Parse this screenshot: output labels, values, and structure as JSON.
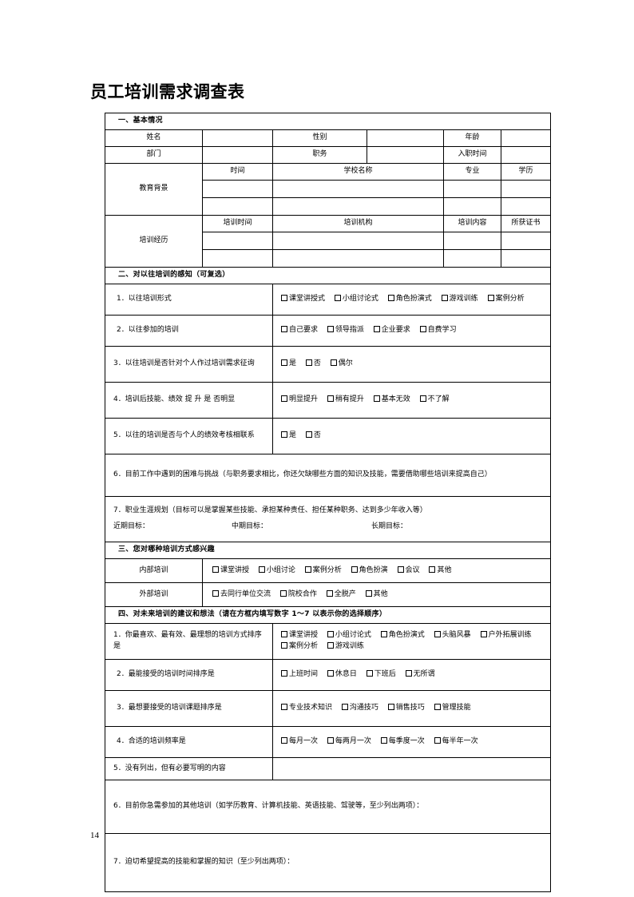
{
  "document": {
    "title": "员工培训需求调查表",
    "page_number": "14"
  },
  "section1": {
    "heading": "一、基本情况",
    "row1": {
      "label1": "姓名",
      "label2": "性别",
      "label3": "年龄"
    },
    "row2": {
      "label1": "部门",
      "label2": "职务",
      "label3": "入职时间"
    },
    "education": {
      "label": "教育背景",
      "headers": [
        "时间",
        "学校名称",
        "专业",
        "学历"
      ]
    },
    "training": {
      "label": "培训经历",
      "headers": [
        "培训时间",
        "培训机构",
        "培训内容",
        "所获证书"
      ]
    }
  },
  "section2": {
    "heading": "二、对以往培训的感知（可复选）",
    "q1": {
      "label": "1．以往培训形式",
      "options": [
        "课堂讲授式",
        "小组讨论式",
        "角色扮演式",
        "游戏训练",
        "案例分析"
      ]
    },
    "q2": {
      "label": "2．以往参加的培训",
      "options": [
        "自己要求",
        "领导指派",
        "企业要求",
        "自费学习"
      ]
    },
    "q3": {
      "label": "3．以往培训是否针对个人作过培训需求征询",
      "options": [
        "是",
        "否",
        "偶尔"
      ]
    },
    "q4": {
      "label": "4．培训后技能、绩效 提 升 是 否明显",
      "options": [
        "明显提升",
        "稍有提升",
        "基本无效",
        "不了解"
      ]
    },
    "q5": {
      "label": "5．以往的培训是否与个人的绩效考核相联系",
      "options": [
        "是",
        "否"
      ]
    },
    "q6": {
      "label": "6．目前工作中遇到的困难与挑战（与职务要求相比，你还欠缺哪些方面的知识及技能，需要借助哪些培训来提高自己）"
    },
    "q7": {
      "label": "7．职业生涯规划（目标可以是掌握某些技能、承担某种责任、担任某种职务、达到多少年收入等）",
      "goal_short": "近期目标：",
      "goal_mid": "中期目标：",
      "goal_long": "长期目标："
    }
  },
  "section3": {
    "heading": "三、您对哪种培训方式感兴趣",
    "internal": {
      "label": "内部培训",
      "options": [
        "课堂讲授",
        "小组讨论",
        "案例分析",
        "角色扮演",
        "会议",
        "其他"
      ]
    },
    "external": {
      "label": "外部培训",
      "options": [
        "去同行单位交流",
        "院校合作",
        "全脱产",
        "其他"
      ]
    }
  },
  "section4": {
    "heading": "四、对未来培训的建议和想法（请在方框内填写数字 1～7 以表示你的选择顺序）",
    "q1": {
      "label": "1．你最喜欢、最有效、最理想的培训方式排序是",
      "options": [
        "课堂讲授",
        "小组讨论式",
        "角色扮演式",
        "头脑风暴",
        "户外拓展训练",
        "案例分析",
        "游戏训练"
      ]
    },
    "q2": {
      "label": "2．最能接受的培训时间排序是",
      "options": [
        "上班时间",
        "休息日",
        "下班后",
        "无所谓"
      ]
    },
    "q3": {
      "label": "3．最想要接受的培训课题排序是",
      "options": [
        "专业技术知识",
        "沟通技巧",
        "销售技巧",
        "管理技能"
      ]
    },
    "q4": {
      "label": "4．合适的培训频率是",
      "options": [
        "每月一次",
        "每两月一次",
        "每季度一次",
        "每半年一次"
      ]
    },
    "q5": {
      "label": "5．没有列出，但有必要写明的内容"
    },
    "q6": {
      "label": "6．目前你急需参加的其他培训（如学历教育、计算机技能、英语技能、驾驶等，至少列出两项）："
    },
    "q7": {
      "label": "7．迫切希望提高的技能和掌握的知识（至少列出两项）："
    }
  }
}
